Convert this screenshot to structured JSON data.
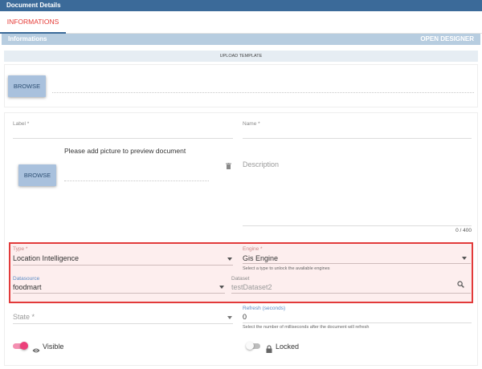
{
  "window": {
    "title": "Document Details"
  },
  "tabs": [
    {
      "label": "INFORMATIONS"
    }
  ],
  "section": {
    "title": "Informations",
    "action": "OPEN DESIGNER"
  },
  "upload": {
    "bar_label": "UPLOAD TEMPLATE",
    "browse_label": "BROWSE"
  },
  "preview": {
    "message": "Please add picture to preview document",
    "browse_label": "BROWSE"
  },
  "fields": {
    "label": {
      "label": "Label *",
      "value": ""
    },
    "name": {
      "label": "Name *",
      "value": ""
    },
    "description": {
      "placeholder": "Description",
      "counter": "0 / 400"
    },
    "type": {
      "label": "Type *",
      "value": "Location Intelligence"
    },
    "engine": {
      "label": "Engine *",
      "value": "Gis Engine",
      "hint": "Select a type to unlock the available engines"
    },
    "datasource": {
      "label": "Datasource",
      "value": "foodmart"
    },
    "dataset": {
      "label": "Dataset",
      "value": "testDataset2"
    },
    "state": {
      "placeholder": "State *"
    },
    "refresh": {
      "label": "Refresh (seconds)",
      "value": "0",
      "hint": "Select the number of milliseconds after the document will refresh"
    }
  },
  "toggles": {
    "visible": {
      "label": "Visible",
      "on": true,
      "icon": "eye-icon"
    },
    "locked": {
      "label": "Locked",
      "on": false,
      "icon": "lock-icon"
    }
  },
  "colors": {
    "header": "#3b6a99",
    "accent": "#e53935",
    "toggle_on": "#ec407a",
    "highlight_border": "#e23a3a"
  }
}
